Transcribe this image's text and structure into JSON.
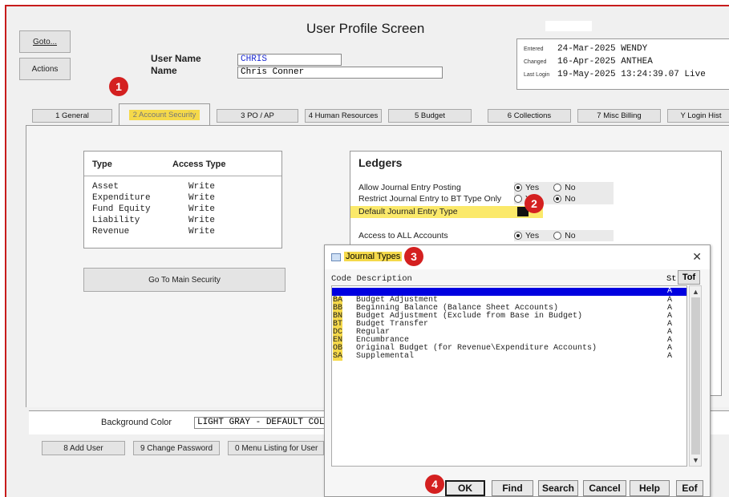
{
  "window": {
    "title": "User Profile Screen"
  },
  "side_buttons": {
    "goto": "Goto...",
    "actions": "Actions"
  },
  "user": {
    "user_name_label": "User Name",
    "user_name": "CHRIS",
    "name_label": "Name",
    "name": "Chris Conner"
  },
  "audit": {
    "entered_label": "Entered",
    "entered": "24-Mar-2025 WENDY",
    "changed_label": "Changed",
    "changed": "16-Apr-2025 ANTHEA",
    "last_login_label": "Last Login",
    "last_login": "19-May-2025 13:24:39.07 Live"
  },
  "tabs": [
    {
      "label": "1 General"
    },
    {
      "label": "2 Account Security"
    },
    {
      "label": "3 PO / AP"
    },
    {
      "label": "4 Human Resources"
    },
    {
      "label": "5 Budget"
    },
    {
      "label": "6 Collections"
    },
    {
      "label": "7 Misc Billing"
    },
    {
      "label": "Y Login Hist"
    }
  ],
  "type_table": {
    "col_type": "Type",
    "col_access": "Access Type",
    "rows": [
      {
        "type": "Asset",
        "access": "Write"
      },
      {
        "type": "Expenditure",
        "access": "Write"
      },
      {
        "type": "Fund Equity",
        "access": "Write"
      },
      {
        "type": "Liability",
        "access": "Write"
      },
      {
        "type": "Revenue",
        "access": "Write"
      }
    ]
  },
  "go_main_security": "Go To Main Security",
  "ledgers": {
    "title": "Ledgers",
    "allow_je_label": "Allow Journal Entry Posting",
    "restrict_je_label": "Restrict Journal Entry to BT Type Only",
    "default_je_label": "Default Journal Entry Type",
    "access_all_label": "Access to ALL Accounts",
    "yes": "Yes",
    "no": "No",
    "allow_je_value": "Yes",
    "restrict_je_value": "No",
    "access_all_value": "Yes"
  },
  "background": {
    "label": "Background Color",
    "value": "LIGHT GRAY - DEFAULT COLOR"
  },
  "bottom_buttons": {
    "add_user": "8 Add User",
    "change_password": "9 Change Password",
    "menu_listing": "0 Menu Listing for User"
  },
  "badges": [
    "1",
    "2",
    "3",
    "4"
  ],
  "dialog": {
    "title": "Journal Types",
    "col_code_desc": "Code Description",
    "col_status": "St",
    "tof": "Tof",
    "selected_row_status": "A",
    "items": [
      {
        "code": "BA",
        "description": "Budget Adjustment",
        "status": "A"
      },
      {
        "code": "BB",
        "description": "Beginning Balance (Balance Sheet Accounts)",
        "status": "A"
      },
      {
        "code": "BN",
        "description": "Budget Adjustment (Exclude from Base in Budget)",
        "status": "A"
      },
      {
        "code": "BT",
        "description": "Budget Transfer",
        "status": "A"
      },
      {
        "code": "DC",
        "description": "Regular",
        "status": "A"
      },
      {
        "code": "EN",
        "description": "Encumbrance",
        "status": "A"
      },
      {
        "code": "OB",
        "description": "Original Budget (for Revenue\\Expenditure Accounts)",
        "status": "A"
      },
      {
        "code": "SA",
        "description": "Supplemental",
        "status": "A"
      }
    ],
    "buttons": {
      "ok": "OK",
      "find": "Find",
      "search": "Search",
      "cancel": "Cancel",
      "help": "Help",
      "eof": "Eof"
    }
  },
  "colors": {
    "frame_border": "#c71b1b",
    "highlight": "#f5d94a",
    "selection": "#0000e0",
    "badge": "#d42020"
  }
}
